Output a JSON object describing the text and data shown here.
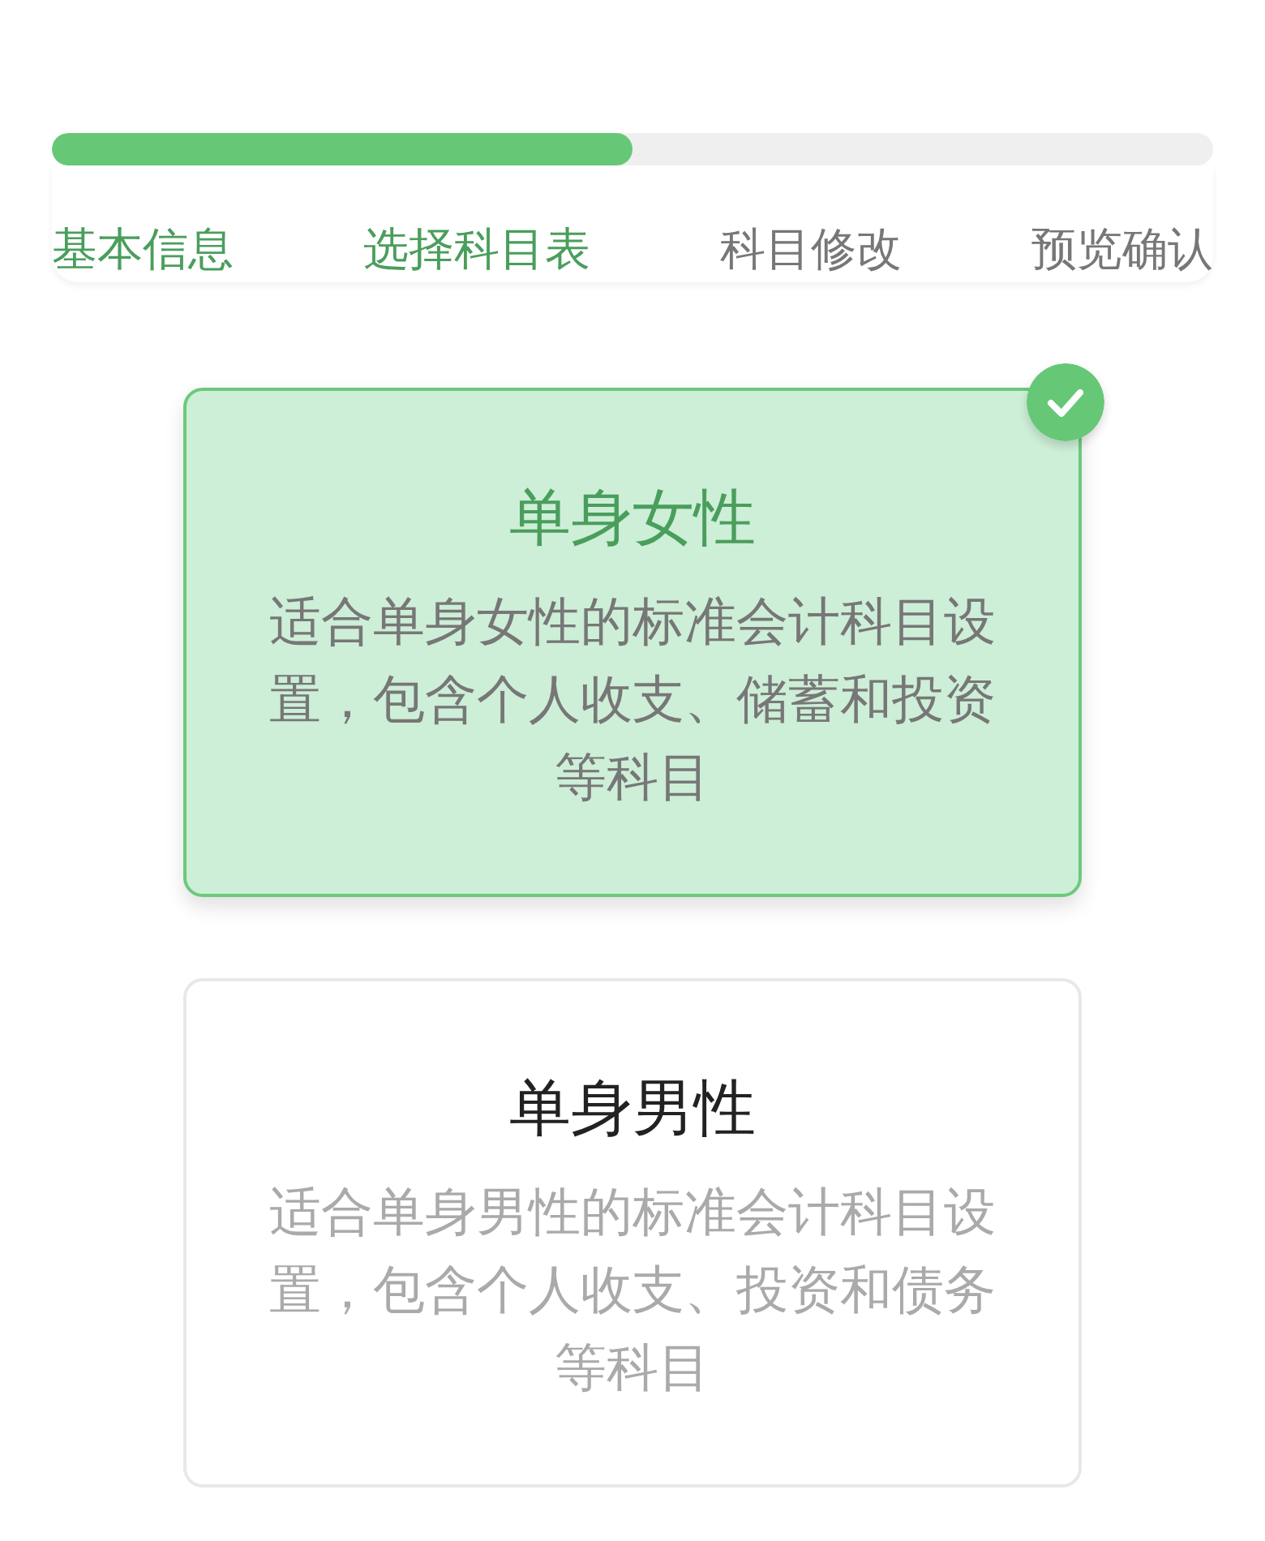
{
  "progress": {
    "level": 0.5
  },
  "steps": [
    {
      "label": "基本信息",
      "active": true
    },
    {
      "label": "选择科目表",
      "active": true
    },
    {
      "label": "科目修改",
      "active": false
    },
    {
      "label": "预览确认",
      "active": false
    }
  ],
  "templates": [
    {
      "title": "单身女性",
      "description": "适合单身女性的标准会计科目设置，包含个人收支、储蓄和投资等科目",
      "selected": true
    },
    {
      "title": "单身男性",
      "description": "适合单身男性的标准会计科目设置，包含个人收支、投资和债务等科目",
      "selected": false
    }
  ]
}
